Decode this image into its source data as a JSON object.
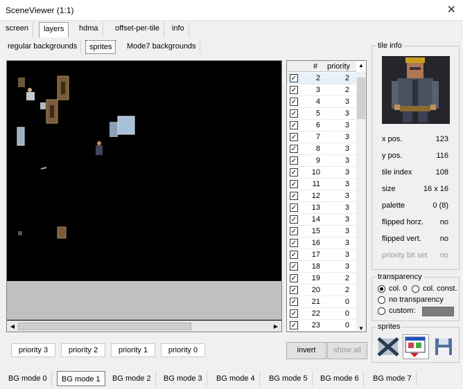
{
  "window": {
    "title": "SceneViewer (1:1)",
    "close_glyph": "✕"
  },
  "main_tabs": [
    "screen",
    "layers",
    "hdma",
    "offset-per-tile",
    "info"
  ],
  "sub_tabs": [
    "regular backgrounds",
    "sprites",
    "Mode7 backgrounds"
  ],
  "list": {
    "headers": [
      "#",
      "priority"
    ],
    "rows": [
      {
        "n": "2",
        "p": "2"
      },
      {
        "n": "3",
        "p": "2"
      },
      {
        "n": "4",
        "p": "3"
      },
      {
        "n": "5",
        "p": "3"
      },
      {
        "n": "6",
        "p": "3"
      },
      {
        "n": "7",
        "p": "3"
      },
      {
        "n": "8",
        "p": "3"
      },
      {
        "n": "9",
        "p": "3"
      },
      {
        "n": "10",
        "p": "3"
      },
      {
        "n": "11",
        "p": "3"
      },
      {
        "n": "12",
        "p": "3"
      },
      {
        "n": "13",
        "p": "3"
      },
      {
        "n": "14",
        "p": "3"
      },
      {
        "n": "15",
        "p": "3"
      },
      {
        "n": "16",
        "p": "3"
      },
      {
        "n": "17",
        "p": "3"
      },
      {
        "n": "18",
        "p": "3"
      },
      {
        "n": "19",
        "p": "2"
      },
      {
        "n": "20",
        "p": "2"
      },
      {
        "n": "21",
        "p": "0"
      },
      {
        "n": "22",
        "p": "0"
      },
      {
        "n": "23",
        "p": "0"
      }
    ]
  },
  "tile_info": {
    "legend": "tile info",
    "fields": [
      {
        "k": "x pos.",
        "v": "123"
      },
      {
        "k": "y pos.",
        "v": "116"
      },
      {
        "k": "tile index",
        "v": "108"
      },
      {
        "k": "size",
        "v": "16 x 16"
      },
      {
        "k": "palette",
        "v": "0 (8)"
      },
      {
        "k": "flipped horz.",
        "v": "no"
      },
      {
        "k": "flipped vert.",
        "v": "no"
      },
      {
        "k": "priority bit set",
        "v": "no"
      }
    ]
  },
  "transparency": {
    "legend": "transparency",
    "col0": "col. 0",
    "colconst": "col. const.",
    "none": "no transparency",
    "custom": "custom:",
    "custom_color": "#7c7c7c"
  },
  "sprites_box": {
    "legend": "sprites"
  },
  "priority_buttons": [
    "priority 3",
    "priority 2",
    "priority 1",
    "priority 0"
  ],
  "buttons": {
    "invert": "invert",
    "show_all": "show all"
  },
  "bg_modes": [
    "BG mode 0",
    "BG mode 1",
    "BG mode 2",
    "BG mode 3",
    "BG mode 4",
    "BG mode 5",
    "BG mode 6",
    "BG mode 7"
  ]
}
